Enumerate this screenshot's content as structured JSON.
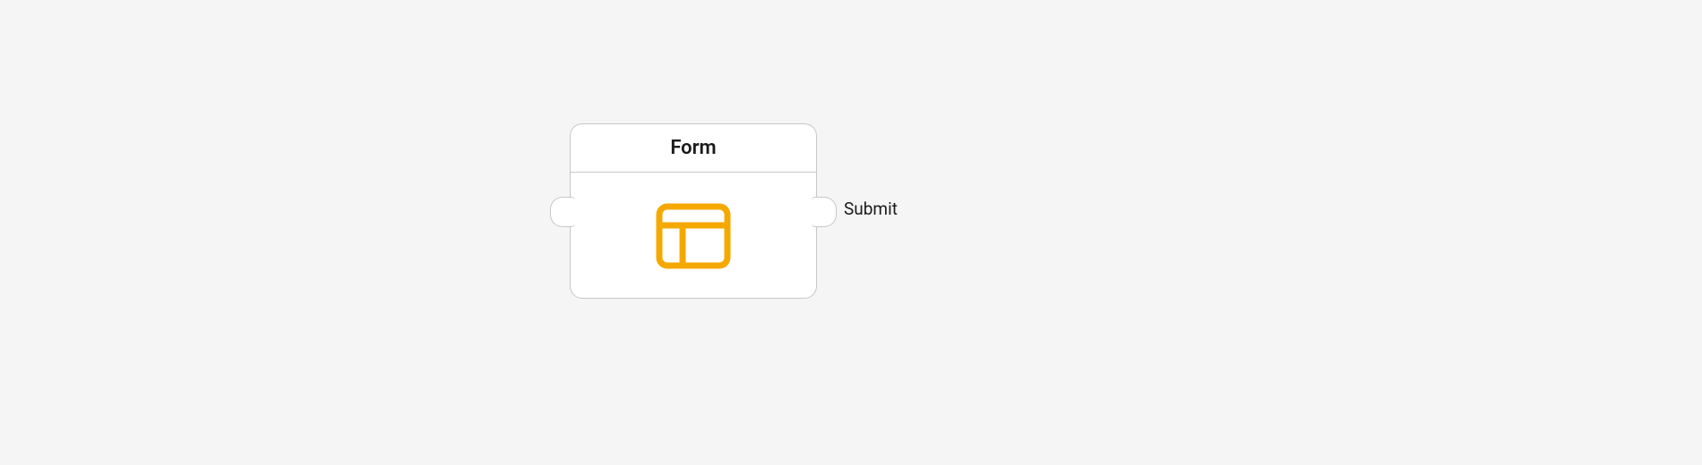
{
  "node": {
    "title": "Form",
    "ports": {
      "output_label": "Submit"
    }
  },
  "colors": {
    "accent": "#f5a900"
  }
}
